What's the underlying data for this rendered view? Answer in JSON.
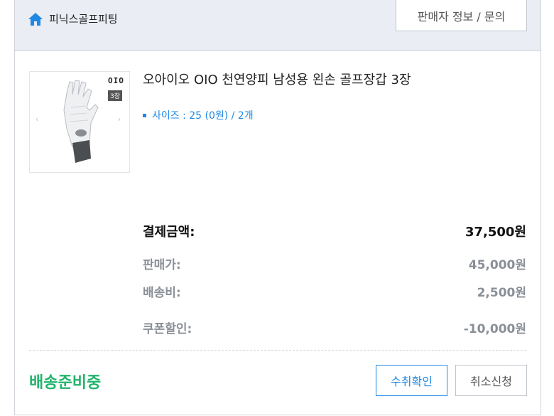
{
  "header": {
    "store_name": "피닉스골프피팅",
    "seller_button_label": "판매자 정보 / 문의",
    "home_icon": "home-icon"
  },
  "product": {
    "thumbnail": {
      "brand_text": "OIO",
      "quantity_badge": "3장",
      "prev_arrow": "‹",
      "next_arrow": "›"
    },
    "name": "오아이오 OIO 천연양피 남성용 왼손 골프장갑 3장",
    "option": "사이즈 : 25 (0원) / 2개"
  },
  "prices": {
    "total": {
      "label": "결제금액:",
      "value": "37,500원"
    },
    "rows": [
      {
        "label": "판매가:",
        "value": "45,000원"
      },
      {
        "label": "배송비:",
        "value": "2,500원"
      },
      {
        "label": "쿠폰할인:",
        "value": "-10,000원"
      }
    ]
  },
  "footer": {
    "status": "배송준비중",
    "confirm_button": "수취확인",
    "cancel_button": "취소신청"
  },
  "colors": {
    "accent_blue": "#1e88e5",
    "status_green": "#21b36b",
    "header_bg": "#eaedf4"
  }
}
